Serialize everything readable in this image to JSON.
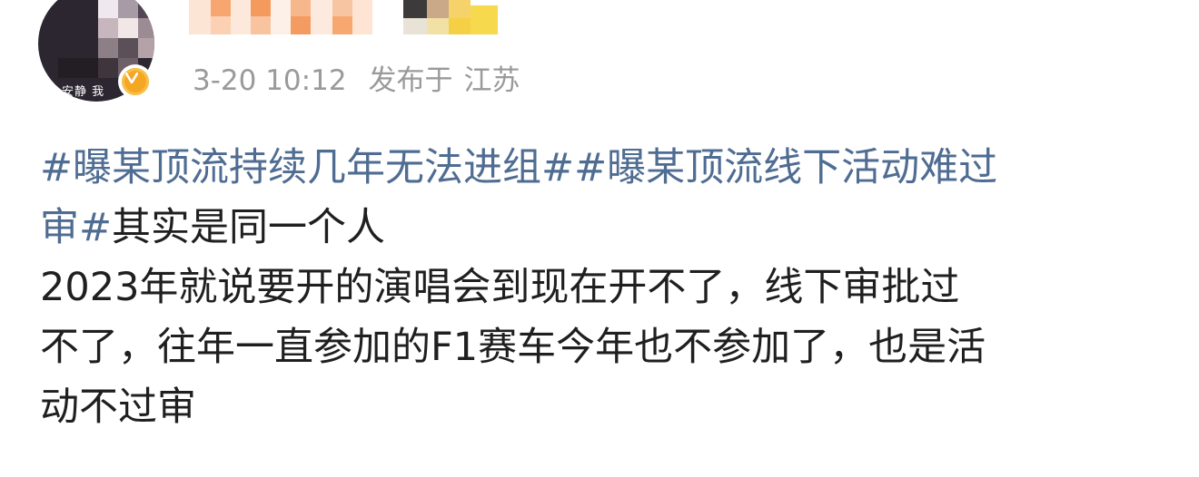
{
  "post": {
    "avatar_caption": "安静 我",
    "timestamp": "3-20 10:12",
    "location_prefix": "发布于",
    "location": "江苏",
    "hashtags": [
      "#曝某顶流持续几年无法进组#",
      "#曝某顶流线下活动难过审#"
    ],
    "hashtag2_part1": "#曝某顶流线下活动难过",
    "hashtag2_part2": "审#",
    "text_after_tags": "其实是同一个人",
    "paragraph_lines": [
      "2023年就说要开的演唱会到现在开不了，线下审批过",
      "不了，往年一直参加的F1赛车今年也不参加了，也是活",
      "动不过审"
    ]
  },
  "colors": {
    "hashtag": "#4f6c92",
    "meta": "#9a9a9a",
    "text": "#1f1f1f",
    "verified_badge": "#f5a623"
  },
  "icons": {
    "verified": "verified-v-badge-icon"
  }
}
